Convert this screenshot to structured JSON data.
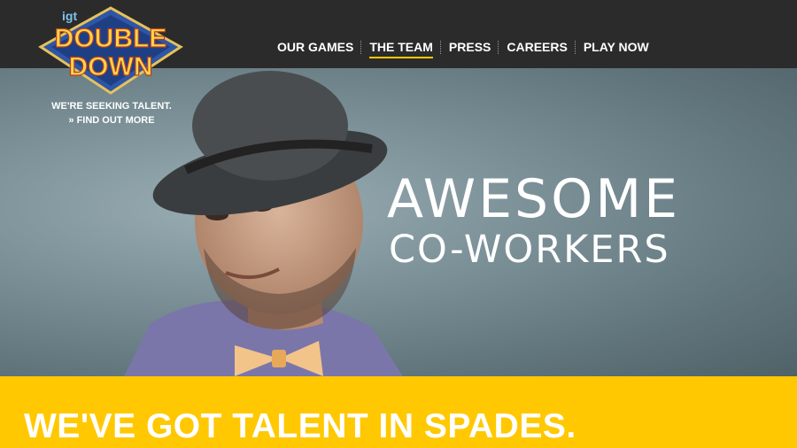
{
  "header": {
    "logo": {
      "brand_small": "igt",
      "line1": "DOUBLE",
      "line2": "DOWN"
    },
    "nav": [
      {
        "label": "OUR GAMES",
        "active": false
      },
      {
        "label": "THE TEAM",
        "active": true
      },
      {
        "label": "PRESS",
        "active": false
      },
      {
        "label": "CAREERS",
        "active": false
      },
      {
        "label": "PLAY NOW",
        "active": false
      }
    ]
  },
  "promo": {
    "seeking": "WE'RE SEEKING TALENT.",
    "find_more": "» FIND OUT MORE"
  },
  "hero": {
    "line1": "AWESOME",
    "line2": "CO-WORKERS"
  },
  "banner": {
    "headline": "WE'VE GOT TALENT IN SPADES."
  },
  "colors": {
    "accent": "#ffc800",
    "topbar": "#2b2b2b",
    "hero_bg": "#7b9097"
  }
}
